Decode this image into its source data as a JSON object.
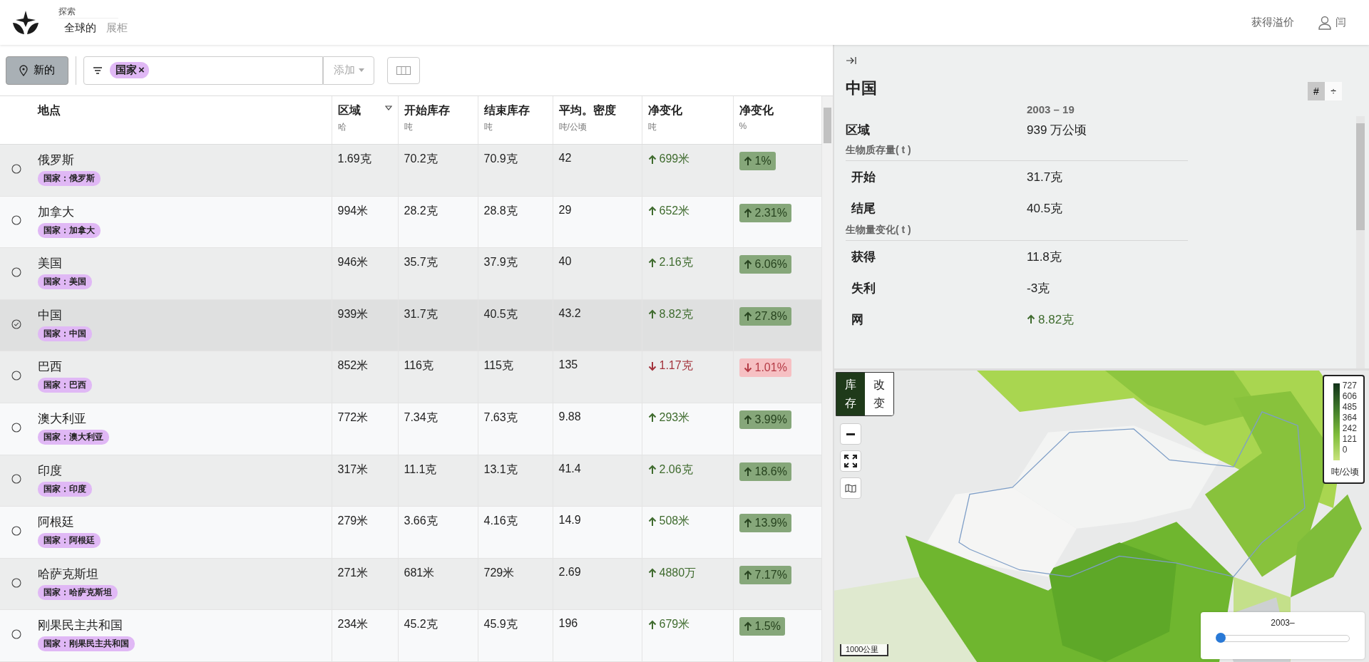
{
  "nav": {
    "section_label": "探索",
    "tabs": [
      {
        "label": "全球的",
        "selected": true
      },
      {
        "label": "展柜",
        "selected": false
      }
    ]
  },
  "account": {
    "upgrade_link": "获得溢价",
    "user": "闫"
  },
  "toolbar": {
    "new_button": "新的",
    "filters": [
      {
        "label": "国家",
        "remove": "×"
      }
    ],
    "add_dropdown": "添加"
  },
  "table": {
    "columns": [
      {
        "title": "地点",
        "sorted": false
      },
      {
        "title": "区域",
        "unit": "哈",
        "sorted": true
      },
      {
        "title": "开始库存",
        "unit": "吨",
        "sorted": false
      },
      {
        "title": "结束库存",
        "unit": "吨",
        "sorted": false
      },
      {
        "title": "平均。密度",
        "unit": "吨/公顷",
        "sorted": false
      },
      {
        "title": "净变化",
        "unit": "吨",
        "sorted": false
      },
      {
        "title": "净变化",
        "unit": "%",
        "sorted": false
      }
    ],
    "rows": [
      {
        "name": "俄罗斯",
        "tag": "国家：俄罗斯",
        "selected": false,
        "area": "1.69克",
        "start": "70.2克",
        "end": "70.9克",
        "density": "42",
        "increase": true,
        "change": "699米",
        "change_pct": "1%"
      },
      {
        "name": "加拿大",
        "tag": "国家：加拿大",
        "selected": false,
        "area": "994米",
        "start": "28.2克",
        "end": "28.8克",
        "density": "29",
        "increase": true,
        "change": "652米",
        "change_pct": "2.31%"
      },
      {
        "name": "美国",
        "tag": "国家：美国",
        "selected": false,
        "area": "946米",
        "start": "35.7克",
        "end": "37.9克",
        "density": "40",
        "increase": true,
        "change": "2.16克",
        "change_pct": "6.06%"
      },
      {
        "name": "中国",
        "tag": "国家：中国",
        "selected": true,
        "area": "939米",
        "start": "31.7克",
        "end": "40.5克",
        "density": "43.2",
        "increase": true,
        "change": "8.82克",
        "change_pct": "27.8%"
      },
      {
        "name": "巴西",
        "tag": "国家：巴西",
        "selected": false,
        "area": "852米",
        "start": "116克",
        "end": "115克",
        "density": "135",
        "increase": false,
        "change": "1.17克",
        "change_pct": "1.01%"
      },
      {
        "name": "澳大利亚",
        "tag": "国家：澳大利亚",
        "selected": false,
        "area": "772米",
        "start": "7.34克",
        "end": "7.63克",
        "density": "9.88",
        "increase": true,
        "change": "293米",
        "change_pct": "3.99%"
      },
      {
        "name": "印度",
        "tag": "国家：印度",
        "selected": false,
        "area": "317米",
        "start": "11.1克",
        "end": "13.1克",
        "density": "41.4",
        "increase": true,
        "change": "2.06克",
        "change_pct": "18.6%"
      },
      {
        "name": "阿根廷",
        "tag": "国家：阿根廷",
        "selected": false,
        "area": "279米",
        "start": "3.66克",
        "end": "4.16克",
        "density": "14.9",
        "increase": true,
        "change": "508米",
        "change_pct": "13.9%"
      },
      {
        "name": "哈萨克斯坦",
        "tag": "国家：哈萨克斯坦",
        "selected": false,
        "area": "271米",
        "start": "681米",
        "end": "729米",
        "density": "2.69",
        "increase": true,
        "change": "4880万",
        "change_pct": "7.17%"
      },
      {
        "name": "刚果民主共和国",
        "tag": "国家：刚果民主共和国",
        "selected": false,
        "area": "234米",
        "start": "45.2克",
        "end": "45.9克",
        "density": "196",
        "increase": true,
        "change": "679米",
        "change_pct": "1.5%"
      }
    ]
  },
  "detail": {
    "title": "中国",
    "period": "2003 – 19",
    "view_toggle": [
      {
        "label": "#",
        "selected": true
      },
      {
        "label": "÷",
        "selected": false
      }
    ],
    "rows": [
      {
        "kind": "row",
        "label": "区域",
        "value": "939 万公顷"
      },
      {
        "kind": "section",
        "label": "生物质存量( t )"
      },
      {
        "kind": "sub",
        "label": "开始",
        "value": "31.7克"
      },
      {
        "kind": "sub",
        "label": "结尾",
        "value": "40.5克"
      },
      {
        "kind": "section",
        "label": "生物量变化( t )"
      },
      {
        "kind": "sub",
        "label": "获得",
        "value": "11.8克"
      },
      {
        "kind": "sub",
        "label": "失利",
        "value": "-3克"
      },
      {
        "kind": "sub",
        "label": "网",
        "value": "8.82克",
        "increase": true
      }
    ]
  },
  "map": {
    "layer_toggle": [
      {
        "label": "库存",
        "selected": true
      },
      {
        "label": "改变",
        "selected": false
      }
    ],
    "legend": {
      "ticks": [
        "727",
        "606",
        "485",
        "364",
        "242",
        "121",
        "0"
      ],
      "unit": "吨/公顷"
    },
    "scale": "1000公里",
    "time_slider": {
      "label": "2003–",
      "level": 0
    }
  }
}
